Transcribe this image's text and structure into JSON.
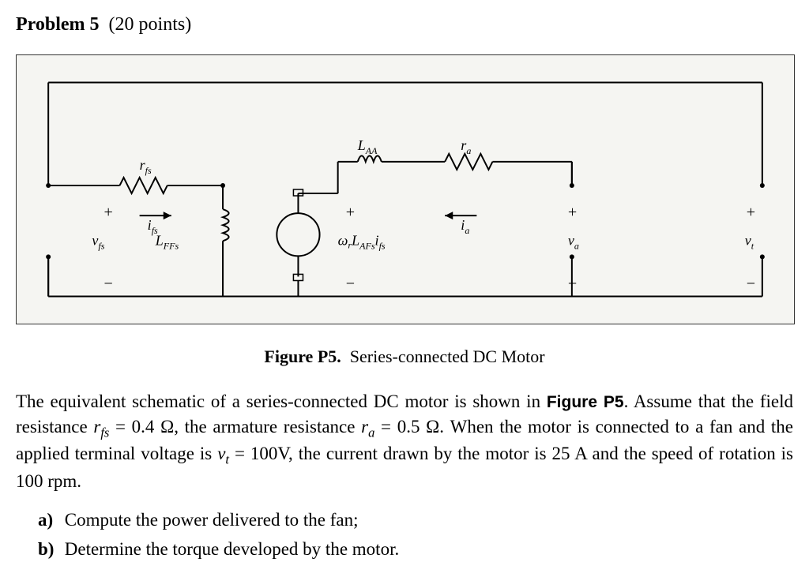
{
  "header": {
    "problem": "Problem 5",
    "points": "(20 points)"
  },
  "figure": {
    "labels": {
      "rfs": "r",
      "rfs_sub": "fs",
      "LAA": "L",
      "LAA_sub": "AA",
      "ra": "r",
      "ra_sub": "a",
      "ifs": "i",
      "ifs_sub": "fs",
      "ia": "i",
      "ia_sub": "a",
      "vfs": "v",
      "vfs_sub": "fs",
      "LFFs": "L",
      "LFFs_sub": "FFs",
      "emf": "ω",
      "emf_rest": "L",
      "emf_sub": "AFs",
      "emf_i": "i",
      "emf_isub": "fs",
      "va": "v",
      "va_sub": "a",
      "vt": "v",
      "vt_sub": "t",
      "plus": "+",
      "minus": "−"
    },
    "caption_bold": "Figure P5.",
    "caption_text": "Series-connected DC Motor"
  },
  "body": {
    "text1": "The equivalent schematic of a series-connected DC motor is shown in ",
    "fig_ref": "Figure P5",
    "text2": ". Assume that the field resistance ",
    "rfs": "r",
    "rfs_sub": "fs",
    "text3": " = 0.4 Ω, the armature resistance ",
    "ra": "r",
    "ra_sub": "a",
    "text4": " = 0.5 Ω. When the motor is connected to a fan and the applied terminal voltage is ",
    "vt": "v",
    "vt_sub": "t",
    "text5": " = 100V, the current drawn by the motor is 25 A and the speed of rotation is 100 rpm."
  },
  "questions": {
    "a_label": "a)",
    "a_text": "Compute the power delivered to the fan;",
    "b_label": "b)",
    "b_text": "Determine the torque developed by the motor."
  }
}
